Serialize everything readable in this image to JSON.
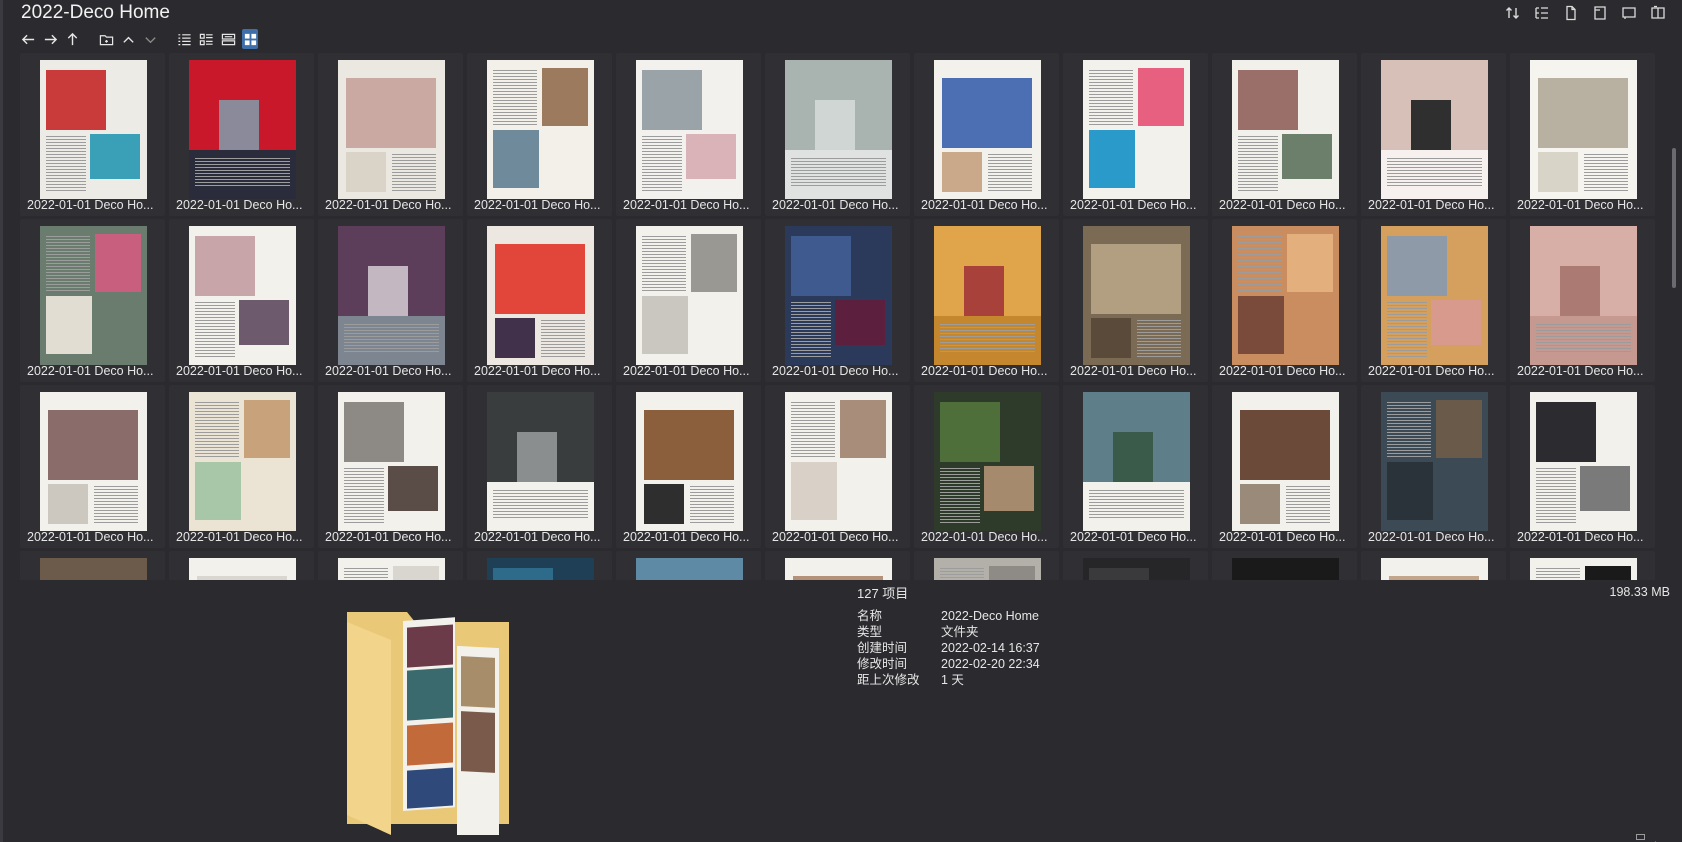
{
  "window": {
    "title": "2022-Deco Home"
  },
  "grid": {
    "item_label": "2022-01-01 Deco Ho...",
    "thumbs": [
      {
        "bg": "#ecebe6",
        "a": "#c93a3a",
        "b": "#3aa0b8"
      },
      {
        "bg": "#2a2c3c",
        "a": "#c8182a",
        "b": "#8a8a9a"
      },
      {
        "bg": "#ebe8e2",
        "a": "#c9a9a2",
        "b": "#d9d3c8"
      },
      {
        "bg": "#f3f0ea",
        "a": "#9c7a5e",
        "b": "#6f8a9a"
      },
      {
        "bg": "#f2f1ee",
        "a": "#9aa4a8",
        "b": "#d9b3b8"
      },
      {
        "bg": "#dfe2e1",
        "a": "#a9b4b1",
        "b": "#cfd6d3"
      },
      {
        "bg": "#f3f1ec",
        "a": "#4c6fb4",
        "b": "#c9a98a"
      },
      {
        "bg": "#f3f1ec",
        "a": "#e7607f",
        "b": "#2a9acb"
      },
      {
        "bg": "#f2f0ea",
        "a": "#9a6e69",
        "b": "#6c7f6a"
      },
      {
        "bg": "#f6f1ee",
        "a": "#d7c0b8",
        "b": "#2f2f2f"
      },
      {
        "bg": "#f5f4ef",
        "a": "#b8b0a0",
        "b": "#d9d4c8"
      },
      {
        "bg": "#6a7c6e",
        "a": "#c95f7f",
        "b": "#e1ddd3"
      },
      {
        "bg": "#f3f1ec",
        "a": "#c8a5a9",
        "b": "#6e5a6d"
      },
      {
        "bg": "#7d8590",
        "a": "#5d3e5a",
        "b": "#c3b8c2"
      },
      {
        "bg": "#ece7e0",
        "a": "#e2463a",
        "b": "#42314b"
      },
      {
        "bg": "#f3f1ec",
        "a": "#9a9892",
        "b": "#c9c7c0"
      },
      {
        "bg": "#2b3a5a",
        "a": "#3e5a8f",
        "b": "#5c1f3d"
      },
      {
        "bg": "#c4872e",
        "a": "#e0a54a",
        "b": "#a8413a"
      },
      {
        "bg": "#7b6b54",
        "a": "#b29e80",
        "b": "#5a4a3a"
      },
      {
        "bg": "#c98d5f",
        "a": "#e3b07d",
        "b": "#7a4a3a"
      },
      {
        "bg": "#d5a05e",
        "a": "#8f9aa8",
        "b": "#d89a8c"
      },
      {
        "bg": "#c59890",
        "a": "#d8afa6",
        "b": "#ab7b73"
      },
      {
        "bg": "#f3f1ec",
        "a": "#8a6c6a",
        "b": "#ccc8c0"
      },
      {
        "bg": "#ebe4d4",
        "a": "#c7a27a",
        "b": "#a8c7a8"
      },
      {
        "bg": "#f3f1ec",
        "a": "#8d8a86",
        "b": "#5a4c47"
      },
      {
        "bg": "#f3f1ec",
        "a": "#3a3d3d",
        "b": "#8a8e8e"
      },
      {
        "bg": "#f3f1ec",
        "a": "#8b5e3c",
        "b": "#2e2e2e"
      },
      {
        "bg": "#f3f1ec",
        "a": "#a88d7a",
        "b": "#d9d0c7"
      },
      {
        "bg": "#2e3a2a",
        "a": "#4e6e3a",
        "b": "#a58a6e"
      },
      {
        "bg": "#f3f1ec",
        "a": "#5e7f8a",
        "b": "#3a5a4a"
      },
      {
        "bg": "#f3f1ec",
        "a": "#6b4a3a",
        "b": "#9a8a7a"
      },
      {
        "bg": "#3c4a56",
        "a": "#6a5a4a",
        "b": "#2a323a"
      },
      {
        "bg": "#f3f1ec",
        "a": "#2c2c30",
        "b": "#7a7a7a"
      },
      {
        "bg": "#f3f1ec",
        "a": "#6c5a4a",
        "b": "#b9a99a"
      },
      {
        "bg": "#f3f1ec",
        "a": "#d9d6cf",
        "b": "#b0aba2"
      },
      {
        "bg": "#f3f1ec",
        "a": "#d9d6cf",
        "b": "#8a9aa6"
      },
      {
        "bg": "#1f3f56",
        "a": "#2e6a8a",
        "b": "#16303f"
      },
      {
        "bg": "#f3f1ec",
        "a": "#5e8aa6",
        "b": "#d9d6cf"
      },
      {
        "bg": "#f3f1ec",
        "a": "#b4927a",
        "b": "#d9cbbd"
      },
      {
        "bg": "#b3afa9",
        "a": "#8e8a85",
        "b": "#d8d4cd"
      },
      {
        "bg": "#262628",
        "a": "#3a3a3c",
        "b": "#1e1e20"
      },
      {
        "bg": "#f3f1ec",
        "a": "#1a1a1a",
        "b": "#ffffff"
      },
      {
        "bg": "#f3f1ec",
        "a": "#c2a58a",
        "b": "#9a8a7a"
      },
      {
        "bg": "#f3f1ec",
        "a": "#1a1a1a",
        "b": "#d9d6cf"
      }
    ],
    "count": 44
  },
  "details": {
    "item_count": "127 项目",
    "total_size": "198.33 MB",
    "properties": [
      {
        "key": "名称",
        "value": "2022-Deco Home"
      },
      {
        "key": "类型",
        "value": "文件夹"
      },
      {
        "key": "创建时间",
        "value": "2022-02-14  16:37"
      },
      {
        "key": "修改时间",
        "value": "2022-02-20  22:34"
      },
      {
        "key": "距上次修改",
        "value": "1 天"
      }
    ]
  },
  "icons": {
    "top_tools": [
      "sort-icon",
      "tree-view-icon",
      "file-icon",
      "panel-right-icon",
      "panel-icon",
      "split-pane-icon"
    ],
    "nav": [
      "back-arrow-icon",
      "forward-arrow-icon",
      "up-arrow-icon",
      "new-folder-icon",
      "chevron-up-icon",
      "chevron-down-icon",
      "list-view-icon",
      "details-view-icon",
      "tiles-view-icon",
      "thumbnail-view-icon"
    ],
    "accent": "#3e6fa8"
  }
}
